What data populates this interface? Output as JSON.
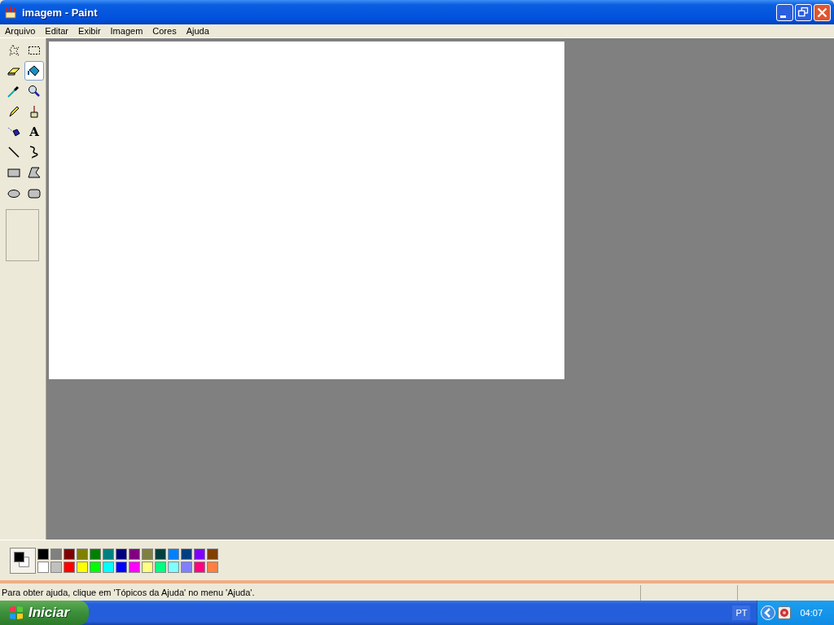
{
  "window": {
    "title": "imagem - Paint"
  },
  "menu": [
    "Arquivo",
    "Editar",
    "Exibir",
    "Imagem",
    "Cores",
    "Ajuda"
  ],
  "tools": [
    {
      "kind": "freeselect",
      "selected": false
    },
    {
      "kind": "select",
      "selected": false
    },
    {
      "kind": "eraser",
      "selected": false
    },
    {
      "kind": "fill",
      "selected": true
    },
    {
      "kind": "picker",
      "selected": false
    },
    {
      "kind": "magnifier",
      "selected": false
    },
    {
      "kind": "pencil",
      "selected": false
    },
    {
      "kind": "brush",
      "selected": false
    },
    {
      "kind": "airbrush",
      "selected": false
    },
    {
      "kind": "text",
      "selected": false,
      "glyph": "A"
    },
    {
      "kind": "line",
      "selected": false
    },
    {
      "kind": "curve",
      "selected": false
    },
    {
      "kind": "rectangle",
      "selected": false
    },
    {
      "kind": "polygon",
      "selected": false
    },
    {
      "kind": "ellipse",
      "selected": false
    },
    {
      "kind": "roundrect",
      "selected": false
    }
  ],
  "selected_colors": [
    {
      "color": "#000000"
    },
    {
      "color": "#ffffff"
    }
  ],
  "palette": [
    {
      "color": "#000000"
    },
    {
      "color": "#808080"
    },
    {
      "color": "#800000"
    },
    {
      "color": "#808000"
    },
    {
      "color": "#008000"
    },
    {
      "color": "#008080"
    },
    {
      "color": "#000080"
    },
    {
      "color": "#800080"
    },
    {
      "color": "#808040"
    },
    {
      "color": "#004040"
    },
    {
      "color": "#0080ff"
    },
    {
      "color": "#004080"
    },
    {
      "color": "#8000ff"
    },
    {
      "color": "#804000"
    },
    {
      "color": "#ffffff"
    },
    {
      "color": "#c0c0c0"
    },
    {
      "color": "#ff0000"
    },
    {
      "color": "#ffff00"
    },
    {
      "color": "#00ff00"
    },
    {
      "color": "#00ffff"
    },
    {
      "color": "#0000ff"
    },
    {
      "color": "#ff00ff"
    },
    {
      "color": "#ffff80"
    },
    {
      "color": "#00ff80"
    },
    {
      "color": "#80ffff"
    },
    {
      "color": "#8080ff"
    },
    {
      "color": "#ff0080"
    },
    {
      "color": "#ff8040"
    }
  ],
  "status_bar": {
    "message": "Para obter ajuda, clique em 'Tópicos da Ajuda' no menu 'Ajuda'."
  },
  "taskbar": {
    "start": "Iniciar",
    "language": "PT",
    "clock": "04:07"
  }
}
